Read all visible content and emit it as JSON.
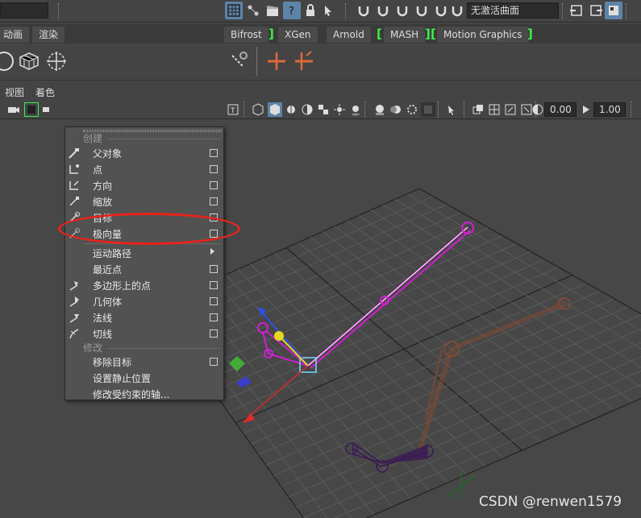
{
  "statusline": {
    "live_surface_label": "无激活曲面"
  },
  "shelf_tabs": {
    "items": [
      "动画",
      "渲染",
      "Bifrost",
      "XGen",
      "Arnold",
      "MASH",
      "Motion Graphics"
    ]
  },
  "panel_menu": {
    "items": [
      "视图",
      "着色"
    ]
  },
  "panel_toolbar": {
    "exposure_value": "0.00",
    "gamma_value": "1.00"
  },
  "menu": {
    "section_create": "创建",
    "section_modify": "修改",
    "items": [
      {
        "label": "父对象",
        "icon": "parent-constraint-icon",
        "option_box": true
      },
      {
        "label": "点",
        "icon": "point-constraint-icon",
        "option_box": true
      },
      {
        "label": "方向",
        "icon": "orient-constraint-icon",
        "option_box": true
      },
      {
        "label": "缩放",
        "icon": "scale-constraint-icon",
        "option_box": true
      },
      {
        "label": "目标",
        "icon": "aim-constraint-icon",
        "option_box": true
      },
      {
        "label": "极向量",
        "icon": "pole-vector-constraint-icon",
        "option_box": true
      },
      {
        "label": "运动路径",
        "icon": "",
        "submenu": true
      },
      {
        "label": "最近点",
        "icon": "",
        "option_box": true
      },
      {
        "label": "多边形上的点",
        "icon": "point-on-poly-icon",
        "option_box": true
      },
      {
        "label": "几何体",
        "icon": "geometry-constraint-icon",
        "option_box": true
      },
      {
        "label": "法线",
        "icon": "normal-constraint-icon",
        "option_box": true
      },
      {
        "label": "切线",
        "icon": "tangent-constraint-icon",
        "option_box": true
      }
    ],
    "modify_items": [
      {
        "label": "移除目标",
        "option_box": true
      },
      {
        "label": "设置静止位置",
        "option_box": false
      },
      {
        "label": "修改受约束的轴...",
        "option_box": false
      }
    ]
  },
  "highlight": {
    "target": "极向量",
    "color": "#e8231c"
  },
  "watermark": "CSDN @renwen1579",
  "colors": {
    "accent_green": "#3cf04a",
    "selection_magenta": "#d21ed2",
    "ghost_orange": "#8a4a30",
    "joint_purple": "#3a1a55"
  }
}
